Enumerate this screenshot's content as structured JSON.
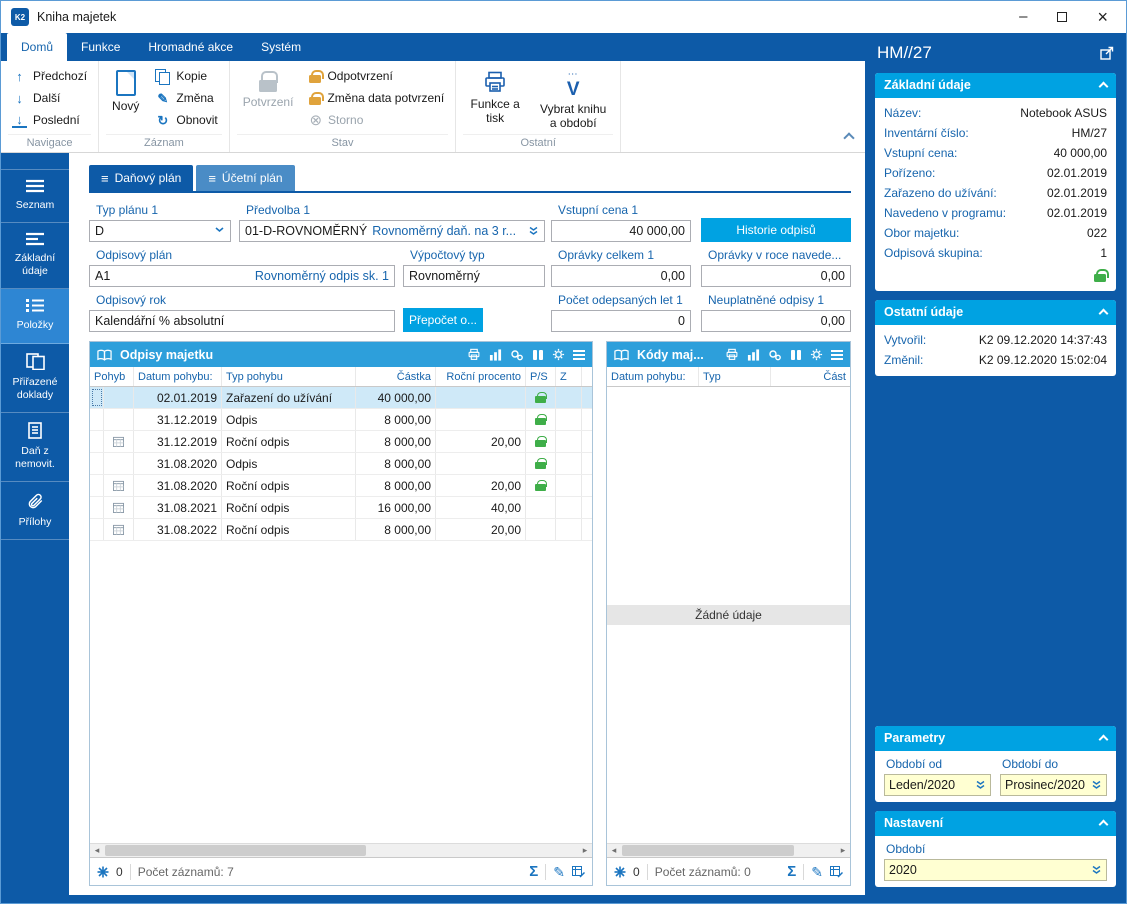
{
  "colors": {
    "dark_blue": "#0d5aa7",
    "accent_cyan": "#00a2e2",
    "table_header_blue": "#2d9fdb",
    "label_blue": "#1765ad",
    "selected_row": "#cfe9f8",
    "lock_green": "#3fae49",
    "lock_gold": "#e0a33c"
  },
  "titlebar": {
    "title": "Kniha majetek"
  },
  "ribbon": {
    "tabs": [
      {
        "label": "Domů"
      },
      {
        "label": "Funkce"
      },
      {
        "label": "Hromadné akce"
      },
      {
        "label": "Systém"
      }
    ],
    "navigace": {
      "label": "Navigace",
      "predchozi": "Předchozí",
      "dalsi": "Další",
      "posledni": "Poslední"
    },
    "zaznam": {
      "label": "Záznam",
      "novy": "Nový",
      "kopie": "Kopie",
      "zmena": "Změna",
      "obnovit": "Obnovit"
    },
    "stav": {
      "label": "Stav",
      "potvrzeni": "Potvrzení",
      "odpotvrzeni": "Odpotvrzení",
      "zmena_data": "Změna data potvrzení",
      "storno": "Storno"
    },
    "ostatni": {
      "label": "Ostatní",
      "funkce_tisk": "Funkce a tisk",
      "vybrat": "Vybrat knihu a období"
    }
  },
  "sidebar": {
    "items": [
      {
        "label": "Seznam"
      },
      {
        "label": "Základní údaje"
      },
      {
        "label": "Položky"
      },
      {
        "label": "Přiřazené doklady"
      },
      {
        "label": "Daň z nemovit."
      },
      {
        "label": "Přílohy"
      }
    ]
  },
  "plan_tabs": {
    "danovy": "Daňový plán",
    "ucetni": "Účetní plán"
  },
  "form": {
    "typ_planu_label": "Typ plánu 1",
    "typ_planu_value": "D",
    "predvolba_label": "Předvolba 1",
    "predvolba_code": "01-D-ROVNOMĚRNÝ",
    "predvolba_desc": "Rovnoměrný daň. na 3 r...",
    "vstupni_cena_label": "Vstupní cena 1",
    "vstupni_cena_value": "40 000,00",
    "historie_button": "Historie odpisů",
    "odpisovy_plan_label": "Odpisový plán",
    "odpisovy_plan_code": "A1",
    "odpisovy_plan_desc": "Rovnoměrný odpis sk. 1",
    "vypoctovy_typ_label": "Výpočtový typ",
    "vypoctovy_typ_value": "Rovnoměrný",
    "opravky_celkem_label": "Oprávky celkem 1",
    "opravky_celkem_value": "0,00",
    "opravky_v_roce_label": "Oprávky v roce navede...",
    "opravky_v_roce_value": "0,00",
    "odpisovy_rok_label": "Odpisový rok",
    "odpisovy_rok_value": "Kalendářní % absolutní",
    "prepocet_button": "Přepočet o...",
    "pocet_let_label": "Počet odepsaných let 1",
    "pocet_let_value": "0",
    "neuplatnene_label": "Neuplatněné odpisy 1",
    "neuplatnene_value": "0,00"
  },
  "odpisy": {
    "title": "Odpisy majetku",
    "columns": {
      "pohyb": "Pohyb",
      "datum": "Datum pohybu:",
      "typ": "Typ pohybu",
      "castka": "Částka",
      "procento": "Roční procento",
      "ps": "P/S",
      "z": "Z"
    },
    "rows": [
      {
        "datum": "02.01.2019",
        "typ": "Zařazení do užívání",
        "castka": "40 000,00",
        "procento": ""
      },
      {
        "datum": "31.12.2019",
        "typ": "Odpis",
        "castka": "8 000,00",
        "procento": ""
      },
      {
        "datum": "31.12.2019",
        "typ": "Roční odpis",
        "castka": "8 000,00",
        "procento": "20,00"
      },
      {
        "datum": "31.08.2020",
        "typ": "Odpis",
        "castka": "8 000,00",
        "procento": ""
      },
      {
        "datum": "31.08.2020",
        "typ": "Roční odpis",
        "castka": "8 000,00",
        "procento": "20,00"
      },
      {
        "datum": "31.08.2021",
        "typ": "Roční odpis",
        "castka": "16 000,00",
        "procento": "40,00"
      },
      {
        "datum": "31.08.2022",
        "typ": "Roční odpis",
        "castka": "8 000,00",
        "procento": "20,00"
      }
    ],
    "footer": {
      "flag_count": "0",
      "records": "Počet záznamů: 7"
    }
  },
  "kody": {
    "title": "Kódy maj...",
    "columns": {
      "datum": "Datum pohybu:",
      "typ": "Typ",
      "castka": "Část"
    },
    "empty": "Žádné údaje",
    "footer": {
      "flag_count": "0",
      "records": "Počet záznamů: 0"
    }
  },
  "panel": {
    "title": "HM//27",
    "zakladni": {
      "title": "Základní údaje",
      "rows": [
        {
          "label": "Název:",
          "value": "Notebook ASUS"
        },
        {
          "label": "Inventární číslo:",
          "value": "HM/27"
        },
        {
          "label": "Vstupní cena:",
          "value": "40 000,00"
        },
        {
          "label": "Pořízeno:",
          "value": "02.01.2019"
        },
        {
          "label": "Zařazeno do užívání:",
          "value": "02.01.2019"
        },
        {
          "label": "Navedeno v programu:",
          "value": "02.01.2019"
        },
        {
          "label": "Obor majetku:",
          "value": "022"
        },
        {
          "label": "Odpisová skupina:",
          "value": "1"
        }
      ]
    },
    "ostatni": {
      "title": "Ostatní údaje",
      "rows": [
        {
          "label": "Vytvořil:",
          "value": "K2 09.12.2020 14:37:43"
        },
        {
          "label": "Změnil:",
          "value": "K2 09.12.2020 15:02:04"
        }
      ]
    },
    "parametry": {
      "title": "Parametry",
      "od_label": "Období od",
      "od_value": "Leden/2020",
      "do_label": "Období do",
      "do_value": "Prosinec/2020"
    },
    "nastaveni": {
      "title": "Nastavení",
      "obdobi_label": "Období",
      "obdobi_value": "2020"
    }
  }
}
